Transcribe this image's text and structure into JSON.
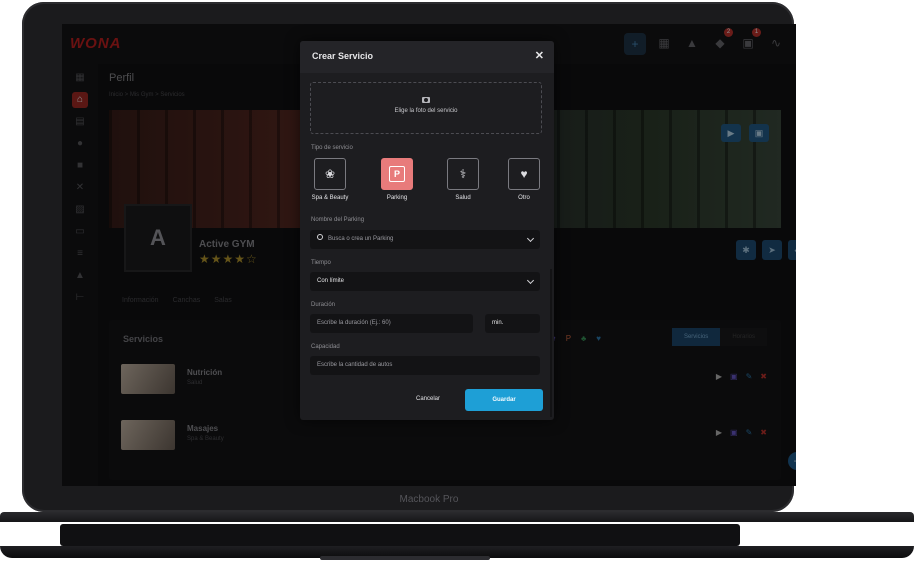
{
  "app": {
    "logo": "WONA",
    "page_title": "Perfil",
    "breadcrumb": "Inicio  >  Mis Gym  >  Servicios",
    "device_label": "Macbook Pro"
  },
  "topbar": {
    "notification_count_1": "2",
    "notification_count_2": "1"
  },
  "profile": {
    "gym_name": "Active GYM",
    "stars": "★★★★☆",
    "avatar_text": "A"
  },
  "profile_tabs": [
    "Información",
    "Canchas",
    "Salas"
  ],
  "services": {
    "header": "Servicios",
    "tab_services": "Servicios",
    "tab_schedule": "Horarios",
    "rows": [
      {
        "name": "Nutrición",
        "category": "Salud"
      },
      {
        "name": "Masajes",
        "category": "Spa & Beauty"
      }
    ]
  },
  "modal": {
    "title": "Crear Servicio",
    "close": "✕",
    "photo_label": "Elige la foto del servicio",
    "type_label": "Tipo de servicio",
    "types": [
      "Spa & Beauty",
      "Parking",
      "Salud",
      "Otro"
    ],
    "selected_type": "Parking",
    "parking_label": "Nombre del Parking",
    "parking_placeholder": "Busca o crea un Parking",
    "time_label": "Tiempo",
    "time_value": "Con límite",
    "duration_label": "Duración",
    "duration_placeholder": "Escribe la duración (Ej.: 60)",
    "duration_unit": "min.",
    "capacity_label": "Capacidad",
    "capacity_placeholder": "Escribe la cantidad de autos",
    "cancel": "Cancelar",
    "save": "Guardar"
  },
  "colors": {
    "accent_blue": "#1e9fd6",
    "selected_type": "#e87b7b",
    "brand_red": "#c21f1f",
    "modal_bg": "#1d1d20"
  }
}
